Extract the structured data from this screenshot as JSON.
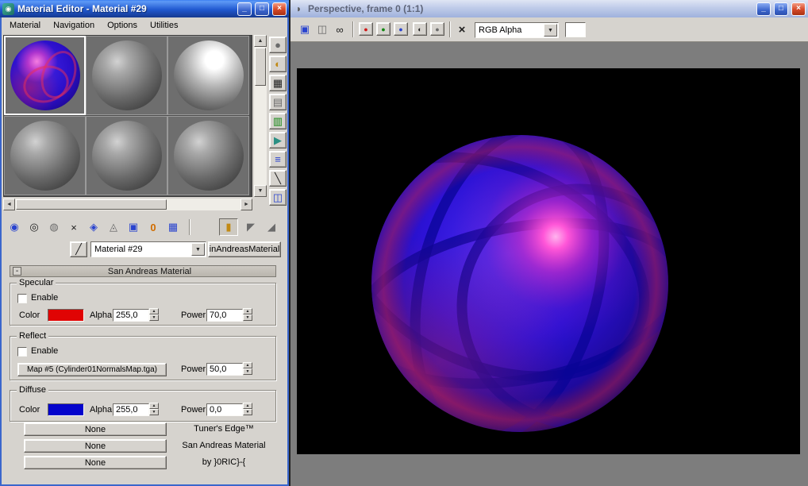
{
  "material_editor": {
    "title": "Material Editor - Material #29",
    "menus": [
      "Material",
      "Navigation",
      "Options",
      "Utilities"
    ],
    "name_combo_value": "Material #29",
    "type_button_label": "inAndreasMaterial",
    "rollout_title": "San Andreas Material",
    "specular": {
      "group_label": "Specular",
      "enable_label": "Enable",
      "color_label": "Color",
      "color_hex": "#e00404",
      "alpha_label": "Alpha",
      "alpha_value": "255,0",
      "power_label": "Power",
      "power_value": "70,0"
    },
    "reflect": {
      "group_label": "Reflect",
      "enable_label": "Enable",
      "map_button_label": "Map #5 (Cylinder01NormalsMap.tga)",
      "power_label": "Power",
      "power_value": "50,0"
    },
    "diffuse": {
      "group_label": "Diffuse",
      "color_label": "Color",
      "color_hex": "#0404cc",
      "alpha_label": "Alpha",
      "alpha_value": "255,0",
      "power_label": "Power",
      "power_value": "0,0"
    },
    "map_slots": [
      "None",
      "None",
      "None"
    ],
    "credits": [
      "Tuner's Edge™",
      "San Andreas Material",
      "by }0RIC}-{"
    ]
  },
  "render_window": {
    "title": "Perspective, frame 0 (1:1)",
    "channel_select_value": "RGB Alpha",
    "swatch_hex": "#ffffff",
    "sphere_colors": {
      "base": "#2c12d6",
      "highlight": "#ff56d8",
      "rim": "#d42448"
    }
  },
  "icons": {
    "app_icon": "◉",
    "render_icon": "◗",
    "minimize": "_",
    "maximize": "□",
    "close": "×",
    "scroll_up": "▲",
    "scroll_down": "▼",
    "scroll_left": "◄",
    "scroll_right": "►",
    "spinner_up": "▲",
    "spinner_down": "▼",
    "dropdown_arrow": "▼",
    "collapse": "-",
    "pick_material": "╱",
    "get_material": "◉",
    "put_material_to_scene": "◎",
    "assign_material": "◍",
    "reset_map": "×",
    "make_copy": "◈",
    "make_unique": "◬",
    "put_to_library": "▣",
    "material_id": "0",
    "show_map_in_viewport": "▦",
    "show_end_result": "▮",
    "go_to_parent": "◤",
    "go_forward": "◢",
    "sample_type": "●",
    "backlight": "◐",
    "background": "▦",
    "sample_uv_tiling": "▤",
    "video_color_check": "▥",
    "make_preview": "▶",
    "options": "≡",
    "select_by_material": "╲",
    "navigator": "◫",
    "save_bitmap": "▣",
    "clone_window": "◫",
    "find_region": "∞",
    "red_channel": "●",
    "green_channel": "●",
    "blue_channel": "●",
    "alpha_channel": "◐",
    "monochrome": "●",
    "clear": "×"
  }
}
